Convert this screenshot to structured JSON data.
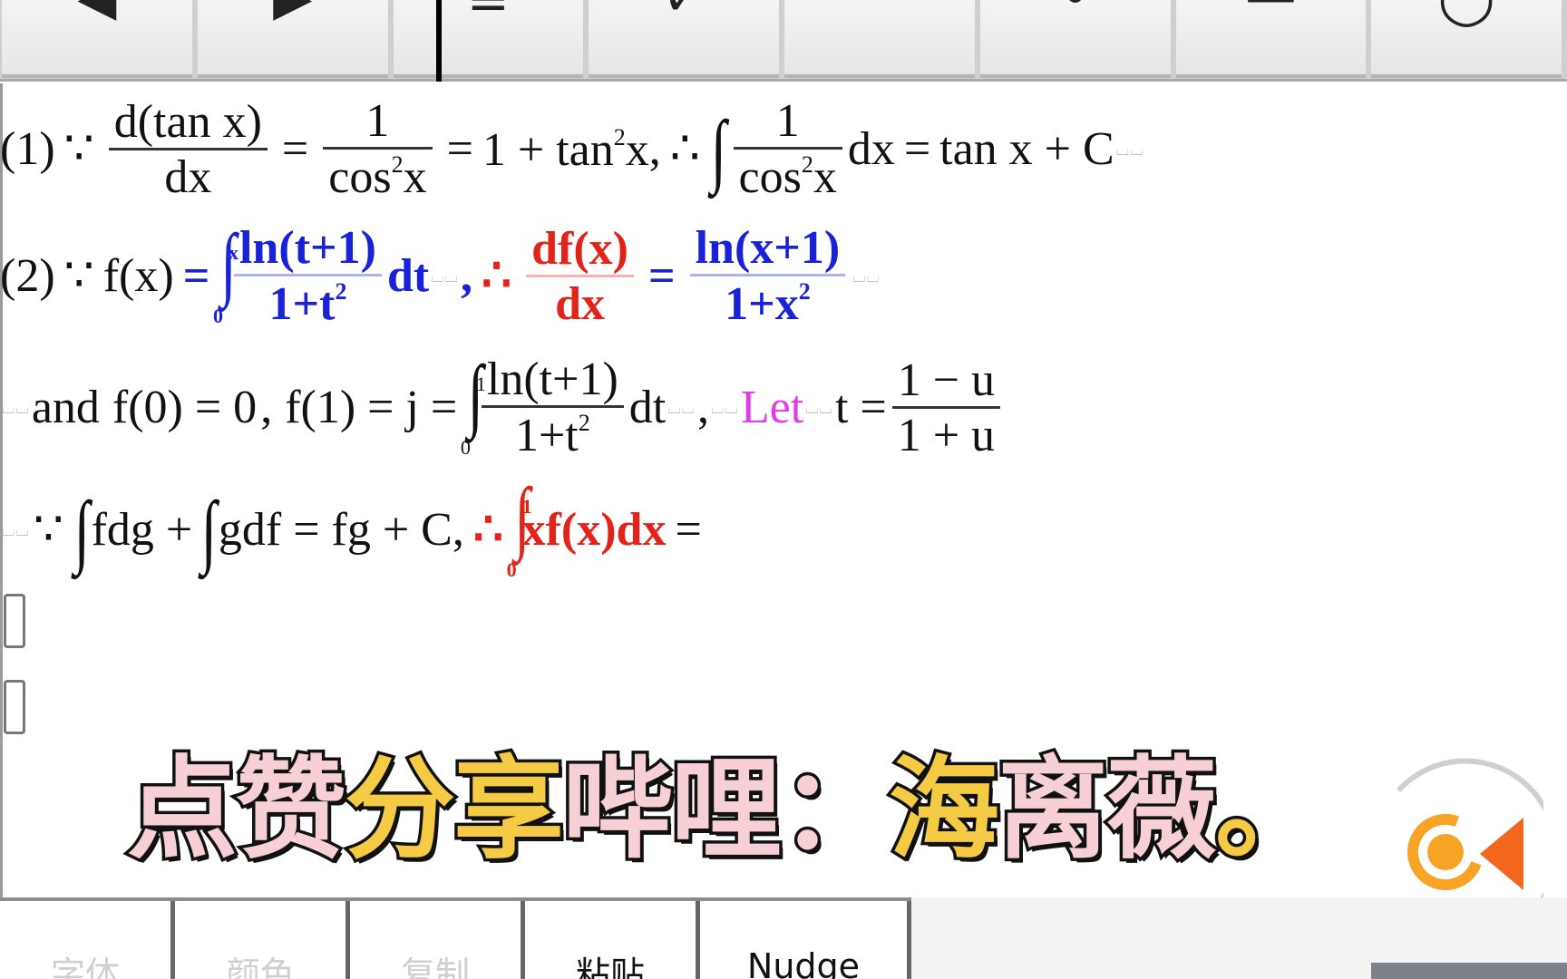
{
  "toolbar": {
    "buttons": [
      {
        "icon": "arrow-left-icon",
        "glyph": "◀"
      },
      {
        "icon": "arrow-right-icon",
        "glyph": "▶"
      },
      {
        "icon": "list-icon",
        "glyph": "≡"
      },
      {
        "icon": "check-icon",
        "glyph": "✓"
      },
      {
        "icon": "colon-dots-icon",
        "glyph": "¨"
      },
      {
        "icon": "dot-icon",
        "glyph": "•"
      },
      {
        "icon": "minus-icon",
        "glyph": "—"
      },
      {
        "icon": "circle-icon",
        "glyph": "◯"
      }
    ]
  },
  "editor": {
    "line1": {
      "label": "(1)",
      "because": "∵",
      "frac1_num": "d(tan x)",
      "frac1_den": "dx",
      "eq": "=",
      "frac2_num": "1",
      "frac2_den_base": "cos",
      "frac2_den_sup": "2",
      "frac2_den_var": "x",
      "rhs1": "1 + tan",
      "rhs1_sup": "2",
      "rhs1_var": "x",
      "comma": ",",
      "therefore": "∴",
      "integral": "∫",
      "frac3_num": "1",
      "frac3_den_base": "cos",
      "frac3_den_sup": "2",
      "frac3_den_var": "x",
      "dx": "dx",
      "result": "tan x + C"
    },
    "line2": {
      "label": "(2)",
      "because": "∵",
      "lhs": "f(x)",
      "eq": "=",
      "integral": "∫",
      "upper": "x",
      "lower": "0",
      "frac_num": "ln(t+1)",
      "frac_den": "1+t",
      "frac_den_sup": "2",
      "dt": "dt",
      "comma": ",",
      "therefore": "∴",
      "deriv_num": "df(x)",
      "deriv_den": "dx",
      "eq2": "=",
      "res_num": "ln(x+1)",
      "res_den": "1+x",
      "res_den_sup": "2"
    },
    "line3": {
      "and": "and",
      "f0": "f(0) = 0",
      "comma": ",",
      "f1": "f(1) = j =",
      "integral": "∫",
      "upper": "1",
      "lower": "0",
      "frac_num": "ln(t+1)",
      "frac_den": "1+t",
      "frac_den_sup": "2",
      "dt": "dt",
      "comma2": ",",
      "let": "Let",
      "t_eq": "t =",
      "sub_num": "1 − u",
      "sub_den": "1 + u"
    },
    "line4": {
      "because": "∵",
      "int1": "∫",
      "term1": "fdg +",
      "int2": "∫",
      "term2": "gdf = fg + C",
      "comma": ",",
      "therefore": "∴",
      "int3": "∫",
      "upper": "1",
      "lower": "0",
      "integrand": "xf(x)dx",
      "eq": "="
    },
    "spacer_dots": "⌴⌴"
  },
  "caption": {
    "parts": [
      {
        "text": "点赞",
        "color": "pink"
      },
      {
        "text": "分享",
        "color": "yellow"
      },
      {
        "text": "哔哩：",
        "color": "pink"
      },
      {
        "text": "海",
        "color": "yellow"
      },
      {
        "text": "离薇",
        "color": "pink"
      },
      {
        "text": "。",
        "color": "yellow"
      }
    ]
  },
  "bottom_buttons": [
    {
      "label": "字体",
      "enabled": false
    },
    {
      "label": "颜色",
      "enabled": false
    },
    {
      "label": "复制",
      "enabled": false
    },
    {
      "label": "粘贴",
      "enabled": true
    },
    {
      "label": "Nudge",
      "enabled": true
    }
  ],
  "colors": {
    "blue_math": "#1a22d8",
    "red_math": "#e2231a",
    "magenta_let": "#e33bea",
    "caption_pink": "#f7d0d5",
    "caption_yellow": "#f5cb45",
    "logo_orange": "#f7a325",
    "logo_red_orange": "#f2671d"
  }
}
